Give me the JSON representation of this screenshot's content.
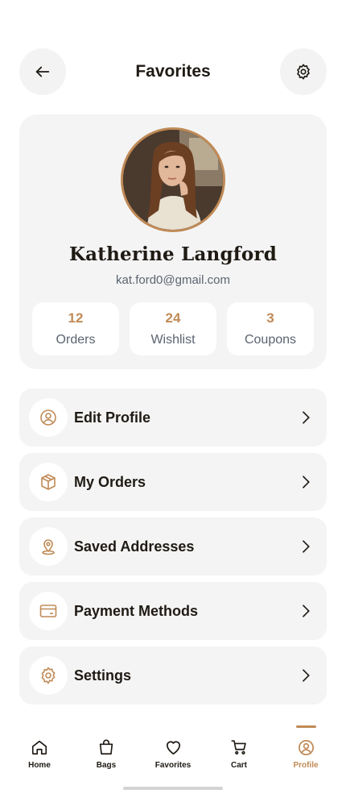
{
  "header": {
    "title": "Favorites",
    "back_icon": "arrow-left-icon",
    "settings_icon": "gear-icon"
  },
  "profile": {
    "name": "Katherine Langford",
    "email": "kat.ford0@gmail.com",
    "stats": [
      {
        "value": "12",
        "label": "Orders"
      },
      {
        "value": "24",
        "label": "Wishlist"
      },
      {
        "value": "3",
        "label": "Coupons"
      }
    ]
  },
  "menu": [
    {
      "label": "Edit Profile",
      "icon": "user-icon"
    },
    {
      "label": "My Orders",
      "icon": "box-icon"
    },
    {
      "label": "Saved Addresses",
      "icon": "location-pin-icon"
    },
    {
      "label": "Payment Methods",
      "icon": "credit-card-icon"
    },
    {
      "label": "Settings",
      "icon": "gear-icon"
    }
  ],
  "nav": [
    {
      "label": "Home",
      "icon": "home-icon",
      "active": false
    },
    {
      "label": "Bags",
      "icon": "bag-icon",
      "active": false
    },
    {
      "label": "Favorites",
      "icon": "heart-icon",
      "active": false
    },
    {
      "label": "Cart",
      "icon": "cart-icon",
      "active": false
    },
    {
      "label": "Profile",
      "icon": "profile-icon",
      "active": true
    }
  ],
  "colors": {
    "accent": "#c08a56",
    "text": "#1f1a14",
    "muted": "#5c6470",
    "card": "#f4f4f4"
  }
}
